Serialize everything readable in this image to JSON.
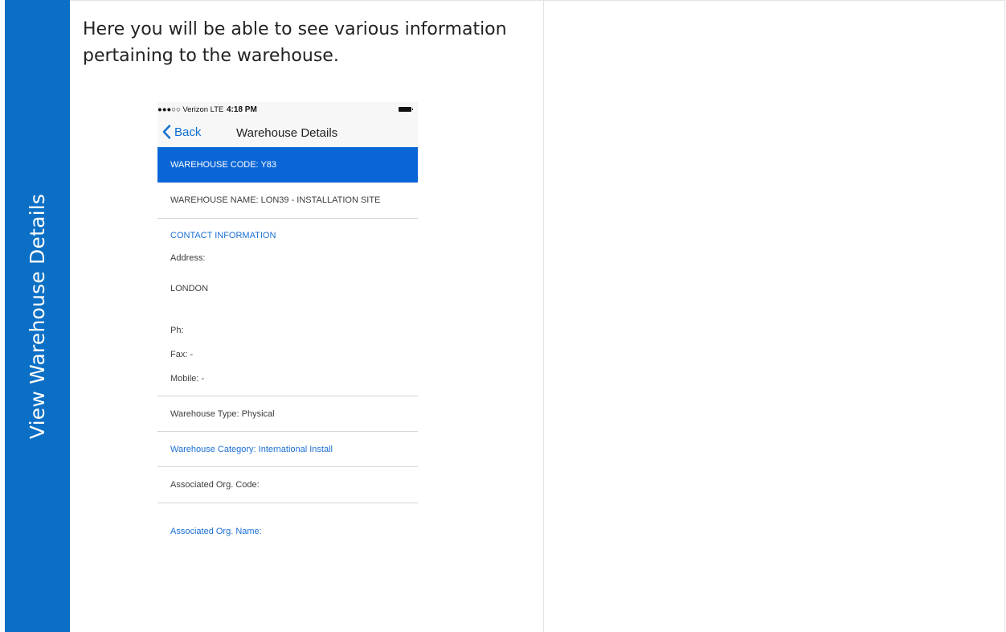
{
  "sidebar": {
    "label": "View Warehouse Details"
  },
  "intro": {
    "text": "Here you will be able to see various information pertaining to the warehouse."
  },
  "phone": {
    "status_bar": {
      "carrier": "●●●○○ Verizon  LTE",
      "time": "4:18 PM"
    },
    "nav": {
      "back_label": "Back",
      "title": "Warehouse Details"
    },
    "warehouse_code": "WAREHOUSE CODE: Y83",
    "warehouse_name": "WAREHOUSE NAME: LON39 - INSTALLATION SITE",
    "contact": {
      "heading": "CONTACT INFORMATION",
      "address_label": "Address:",
      "address_city": "LONDON",
      "phone_label": "Ph:",
      "fax_label": "Fax: -",
      "mobile_label": "Mobile: -"
    },
    "warehouse_type": "Warehouse Type:  Physical",
    "warehouse_category": "Warehouse Category:  International Install",
    "associated_org_code": "Associated Org. Code:",
    "associated_org_name": "Associated Org. Name:"
  },
  "colors": {
    "sidebar_blue": "#0b6fc5",
    "header_blue": "#0a66d6",
    "link_blue": "#1a6fd6"
  }
}
